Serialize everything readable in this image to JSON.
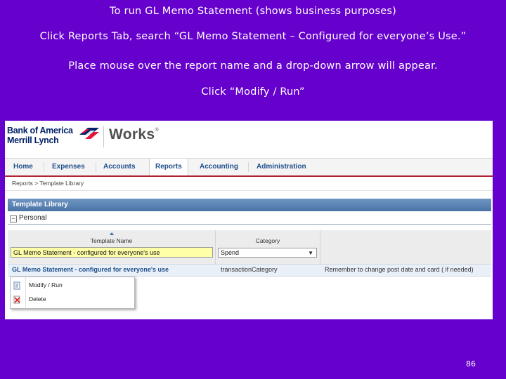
{
  "slide": {
    "title": "To run GL Memo Statement (shows business purposes)",
    "instruction_search": "Click Reports Tab, search “GL Memo Statement – Configured for everyone’s Use.”",
    "instruction_hover": "Place mouse over the report name and a drop-down arrow will appear.",
    "instruction_click": "Click “Modify / Run”",
    "page_number": "86"
  },
  "app": {
    "brand_line1": "Bank of America",
    "brand_line2": "Merrill Lynch",
    "product": "Works",
    "product_mark": "®",
    "nav": [
      "Home",
      "Expenses",
      "Accounts",
      "Reports",
      "Accounting",
      "Administration"
    ],
    "active_nav": "Reports",
    "breadcrumb": "Reports > Template Library",
    "panel_title": "Template Library",
    "group_label": "Personal",
    "columns": {
      "template_name": "Template Name",
      "category": "Category"
    },
    "search_value": "GL Memo Statement - configured for everyone's use",
    "category_selected": "Spend",
    "result": {
      "name": "GL Memo Statement - configured for everyone's use",
      "category": "transactionCategory",
      "note": "Remember to change post date and card ( if needed)"
    },
    "context_menu": {
      "modify_run": "Modify / Run",
      "delete": "Delete"
    }
  },
  "colors": {
    "slide_background": "#6600cc",
    "nav_text": "#1f4e8c",
    "accent_red": "#b22234",
    "panel_header": "#4a73a6",
    "search_highlight": "#ffffa8"
  }
}
